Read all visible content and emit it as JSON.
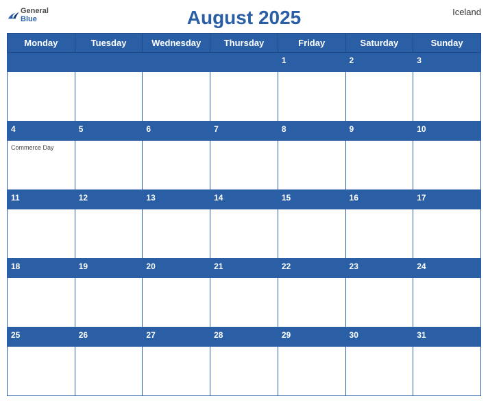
{
  "calendar": {
    "title": "August 2025",
    "country": "Iceland",
    "logo": {
      "general": "General",
      "blue": "Blue"
    },
    "days_of_week": [
      "Monday",
      "Tuesday",
      "Wednesday",
      "Thursday",
      "Friday",
      "Saturday",
      "Sunday"
    ],
    "weeks": [
      {
        "date_numbers": [
          "",
          "",
          "",
          "",
          "1",
          "2",
          "3"
        ],
        "events": [
          "",
          "",
          "",
          "",
          "",
          "",
          ""
        ]
      },
      {
        "date_numbers": [
          "4",
          "5",
          "6",
          "7",
          "8",
          "9",
          "10"
        ],
        "events": [
          "Commerce Day",
          "",
          "",
          "",
          "",
          "",
          ""
        ]
      },
      {
        "date_numbers": [
          "11",
          "12",
          "13",
          "14",
          "15",
          "16",
          "17"
        ],
        "events": [
          "",
          "",
          "",
          "",
          "",
          "",
          ""
        ]
      },
      {
        "date_numbers": [
          "18",
          "19",
          "20",
          "21",
          "22",
          "23",
          "24"
        ],
        "events": [
          "",
          "",
          "",
          "",
          "",
          "",
          ""
        ]
      },
      {
        "date_numbers": [
          "25",
          "26",
          "27",
          "28",
          "29",
          "30",
          "31"
        ],
        "events": [
          "",
          "",
          "",
          "",
          "",
          "",
          ""
        ]
      }
    ]
  }
}
